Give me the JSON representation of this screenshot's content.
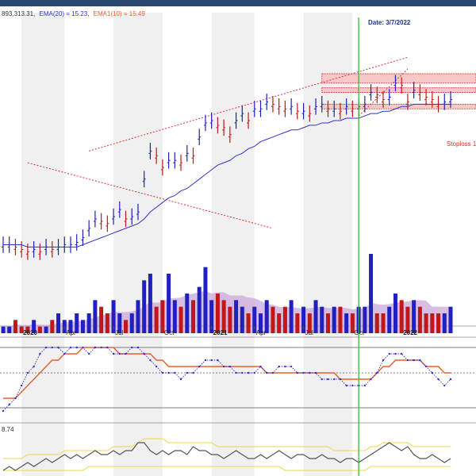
{
  "header": {
    "volume_text": "893,313.31,",
    "ema20_text": "EMA(20) = 15.23,",
    "ema10_text": "EMA1(10) = 15.49"
  },
  "cursor": {
    "label": "Date: 3/7/2022"
  },
  "annotations": {
    "stoploss_text": "Stoploss 1"
  },
  "lower_panel": {
    "value_text": "8.74"
  },
  "colors": {
    "up": "#2020c0",
    "down": "#c01818",
    "ema_fast": "#e06030",
    "ema_slow": "#3030d0",
    "trend": "#e03030",
    "cursor": "#22bb22",
    "band": "#e8d84a",
    "indicator": "#555555",
    "volume_fill": "#c9a3d8"
  },
  "chart_data": {
    "type": "line",
    "x_ticks": [
      "2020",
      "Apr",
      "Jul",
      "Oct",
      "2021",
      "Apr",
      "Jul",
      "Oct",
      "2022"
    ],
    "x_tick_bold": [
      true,
      false,
      false,
      false,
      true,
      false,
      false,
      false,
      true
    ],
    "price": [
      12.0,
      12.0,
      11.9,
      11.8,
      11.7,
      11.8,
      11.7,
      11.9,
      11.8,
      11.9,
      12.0,
      12.0,
      12.1,
      12.3,
      12.7,
      13.1,
      13.0,
      12.9,
      13.2,
      13.5,
      13.1,
      13.2,
      13.4,
      14.8,
      16.0,
      15.8,
      15.3,
      15.6,
      15.6,
      15.5,
      15.9,
      15.8,
      16.6,
      17.2,
      17.3,
      17.1,
      17.0,
      16.7,
      17.3,
      17.6,
      17.3,
      17.8,
      17.8,
      18.1,
      18.0,
      17.9,
      17.8,
      17.9,
      17.7,
      17.7,
      17.6,
      17.9,
      18.0,
      17.8,
      17.8,
      17.7,
      17.9,
      17.8,
      17.9,
      18.0,
      18.5,
      18.4,
      18.2,
      18.3,
      18.9,
      18.8,
      18.1,
      18.6,
      18.5,
      18.3,
      18.2,
      18.0,
      18.1,
      18.2
    ],
    "ema20": [
      12.0,
      12.0,
      12.0,
      12.0,
      11.9,
      11.9,
      11.9,
      11.9,
      11.9,
      11.9,
      11.9,
      11.9,
      11.9,
      12.0,
      12.1,
      12.2,
      12.3,
      12.4,
      12.5,
      12.6,
      12.7,
      12.8,
      12.9,
      13.1,
      13.4,
      13.6,
      13.8,
      14.0,
      14.1,
      14.3,
      14.4,
      14.6,
      14.8,
      15.0,
      15.2,
      15.4,
      15.5,
      15.6,
      15.8,
      15.9,
      16.1,
      16.2,
      16.4,
      16.5,
      16.6,
      16.7,
      16.8,
      16.9,
      16.9,
      17.0,
      17.1,
      17.1,
      17.2,
      17.2,
      17.3,
      17.3,
      17.4,
      17.4,
      17.4,
      17.5,
      17.6,
      17.6,
      17.7,
      17.7,
      17.8,
      17.9,
      17.9,
      18.0,
      18.0,
      18.0,
      18.0,
      18.0,
      18.0,
      18.0
    ],
    "volume": [
      1,
      1,
      2,
      1,
      1,
      2,
      1,
      1,
      2,
      3,
      2,
      2,
      3,
      2,
      3,
      5,
      4,
      3,
      5,
      3,
      2,
      3,
      5,
      8,
      9,
      4,
      5,
      9,
      5,
      4,
      6,
      5,
      7,
      10,
      5,
      6,
      5,
      4,
      5,
      4,
      3,
      4,
      3,
      5,
      4,
      3,
      4,
      5,
      3,
      4,
      3,
      5,
      4,
      3,
      4,
      4,
      3,
      3,
      4,
      4,
      12,
      3,
      3,
      4,
      6,
      5,
      4,
      5,
      4,
      3,
      3,
      3,
      3,
      4
    ],
    "osc": [
      0,
      1,
      2,
      4,
      6,
      7,
      9,
      10,
      10,
      10,
      9,
      10,
      10,
      10,
      9,
      10,
      10,
      10,
      9,
      9,
      9,
      10,
      10,
      9,
      8,
      7,
      6,
      6,
      6,
      5,
      6,
      6,
      7,
      8,
      8,
      8,
      7,
      7,
      6,
      6,
      6,
      6,
      7,
      6,
      6,
      7,
      7,
      7,
      6,
      6,
      6,
      6,
      5,
      5,
      5,
      5,
      4,
      4,
      4,
      4,
      5,
      6,
      8,
      9,
      9,
      9,
      8,
      8,
      8,
      7,
      6,
      5,
      4,
      5
    ],
    "osc_signal": [
      2,
      2,
      2,
      3,
      4,
      5,
      6,
      7,
      8,
      8,
      9,
      9,
      9,
      10,
      10,
      10,
      10,
      10,
      10,
      9,
      9,
      9,
      9,
      9,
      9,
      8,
      8,
      7,
      7,
      7,
      7,
      7,
      7,
      7,
      7,
      7,
      7,
      7,
      7,
      7,
      7,
      7,
      7,
      6,
      6,
      6,
      6,
      6,
      6,
      6,
      6,
      6,
      6,
      6,
      6,
      5,
      5,
      5,
      5,
      5,
      5,
      6,
      7,
      7,
      8,
      8,
      8,
      8,
      8,
      7,
      7,
      7,
      6,
      6
    ],
    "ind": [
      2,
      3,
      2,
      3,
      4,
      3,
      4,
      5,
      4,
      5,
      6,
      5,
      6,
      5,
      6,
      7,
      6,
      6,
      7,
      6,
      7,
      7,
      9,
      9,
      7,
      6,
      7,
      6,
      7,
      7,
      6,
      8,
      7,
      7,
      6,
      6,
      5,
      6,
      7,
      6,
      5,
      5,
      6,
      5,
      6,
      7,
      6,
      5,
      6,
      6,
      5,
      5,
      6,
      5,
      5,
      4,
      5,
      5,
      4,
      5,
      6,
      7,
      8,
      9,
      8,
      7,
      8,
      6,
      5,
      5,
      6,
      5,
      4,
      5
    ],
    "ind_upper": [
      5,
      5,
      5,
      5,
      6,
      6,
      6,
      6,
      6,
      6,
      7,
      7,
      7,
      7,
      7,
      7,
      7,
      7,
      8,
      8,
      8,
      8,
      9,
      10,
      10,
      10,
      10,
      9,
      9,
      9,
      9,
      9,
      9,
      9,
      9,
      8,
      8,
      8,
      8,
      8,
      8,
      8,
      8,
      8,
      8,
      8,
      8,
      8,
      8,
      8,
      8,
      8,
      8,
      8,
      7,
      7,
      7,
      7,
      7,
      7,
      8,
      8,
      9,
      9,
      9,
      9,
      9,
      8,
      8,
      8,
      8,
      8,
      8,
      8
    ],
    "ind_lower": [
      2,
      2,
      2,
      2,
      2,
      2,
      2,
      2,
      2,
      2,
      2,
      2,
      2,
      2,
      3,
      3,
      3,
      3,
      3,
      3,
      3,
      3,
      3,
      3,
      3,
      3,
      3,
      3,
      3,
      3,
      3,
      3,
      3,
      3,
      3,
      3,
      3,
      3,
      3,
      3,
      3,
      3,
      3,
      3,
      3,
      3,
      2,
      2,
      2,
      2,
      2,
      2,
      2,
      2,
      2,
      2,
      2,
      2,
      2,
      2,
      3,
      3,
      3,
      3,
      3,
      3,
      3,
      3,
      3,
      3,
      3,
      3,
      3,
      3
    ],
    "trend_lines": [
      {
        "name": "upper-channel",
        "from": [
          14.0,
          16.0
        ],
        "to": [
          66.0,
          20.0
        ]
      },
      {
        "name": "down-trend",
        "from": [
          4.0,
          15.5
        ],
        "to": [
          44.0,
          12.7
        ]
      },
      {
        "name": "rising-support",
        "from": [
          58.0,
          17.5
        ],
        "to": [
          66.0,
          19.5
        ]
      }
    ],
    "resistance_zones": [
      [
        18.9,
        19.3
      ],
      [
        18.5,
        18.7
      ],
      [
        17.8,
        18.0
      ]
    ],
    "cursor_index": 58
  }
}
